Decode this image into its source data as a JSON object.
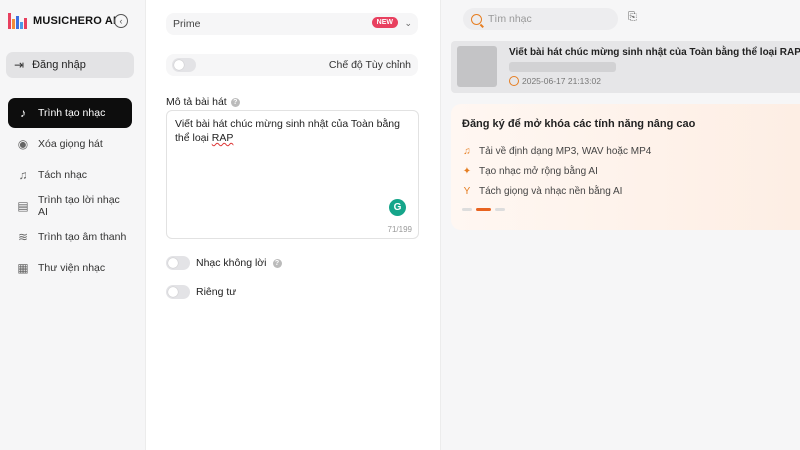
{
  "brand": {
    "name": "MUSICHERO AI",
    "logo_colors": [
      "#e8405f",
      "#f08a3c",
      "#3b6fe0",
      "#4c9be8"
    ]
  },
  "sidebar": {
    "collapse_icon": "chevron-left-icon",
    "login_label": "Đăng nhập",
    "items": [
      {
        "label": "Trình tạo nhạc",
        "icon": "music-note-icon",
        "active": true
      },
      {
        "label": "Xóa giọng hát",
        "icon": "vocal-remove-icon",
        "active": false
      },
      {
        "label": "Tách nhạc",
        "icon": "split-icon",
        "active": false
      },
      {
        "label": "Trình tạo lời nhạc AI",
        "icon": "lyrics-icon",
        "active": false
      },
      {
        "label": "Trình tạo âm thanh",
        "icon": "sound-wave-icon",
        "active": false
      },
      {
        "label": "Thư viện nhạc",
        "icon": "library-icon",
        "active": false
      }
    ]
  },
  "form": {
    "model": {
      "value": "Prime",
      "badge": "NEW"
    },
    "custom_mode_label": "Chế độ Tùy chỉnh",
    "description_label": "Mô tả bài hát",
    "description_text_main": "Viết bài hát chúc mừng sinh nhật của Toàn bằng thể loại ",
    "description_text_underlined": "RAP",
    "char_count": "71/199",
    "instrumental_label": "Nhạc không lời",
    "private_label": "Riêng tư"
  },
  "right": {
    "search_placeholder": "Tìm nhạc",
    "song": {
      "title": "Viết bài hát chúc mừng sinh nhật của Toàn bằng thể loại RAP",
      "timestamp": "2025-06-17 21:13:02"
    },
    "promo": {
      "title": "Đăng ký để mở khóa các tính năng nâng cao",
      "items": [
        {
          "label": "Tải về định dạng MP3, WAV hoặc MP4",
          "icon": "music-note-icon"
        },
        {
          "label": "Tạo nhạc mở rộng bằng AI",
          "icon": "magic-wand-icon"
        },
        {
          "label": "Tách giọng và nhạc nền bằng AI",
          "icon": "split-icon"
        }
      ]
    }
  },
  "colors": {
    "accent": "#e8631f",
    "badge": "#e8405f",
    "active_nav": "#0d0d0d"
  }
}
